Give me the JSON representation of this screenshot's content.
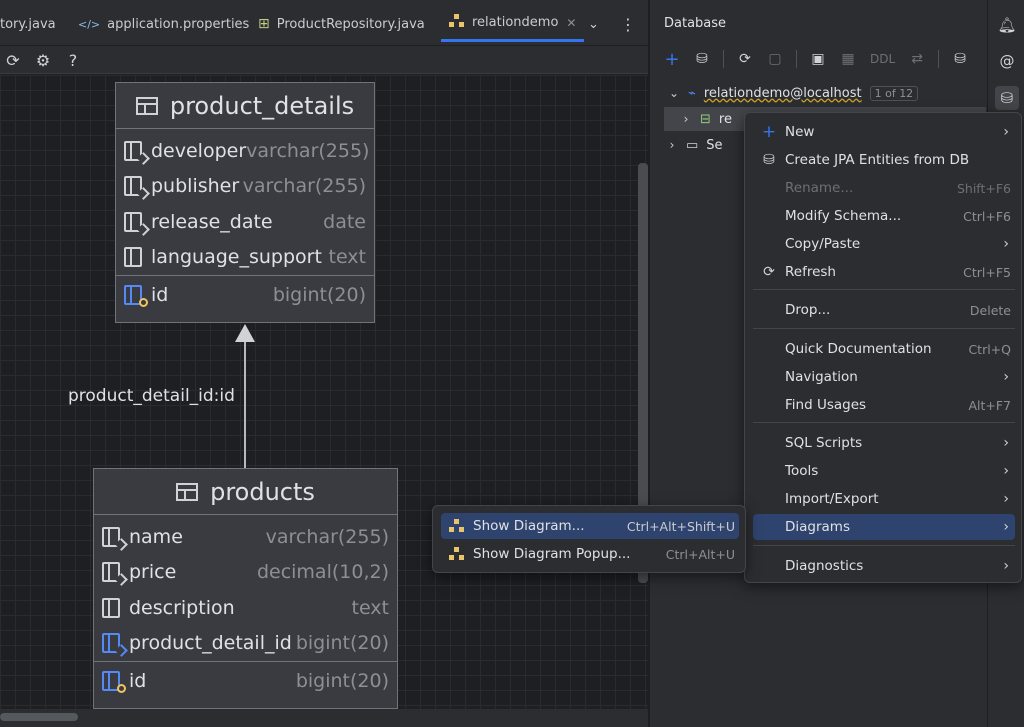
{
  "tabs": [
    {
      "label": "tory.java",
      "icon": "java-file-icon",
      "active": false
    },
    {
      "label": "application.properties",
      "icon": "code-file-icon",
      "active": false
    },
    {
      "label": "ProductRepository.java",
      "icon": "repository-icon",
      "active": false
    },
    {
      "label": "relationdemo",
      "icon": "diagram-icon",
      "active": true
    }
  ],
  "diagram": {
    "tables": [
      {
        "name": "product_details",
        "columns": [
          {
            "name": "developer",
            "type": "varchar(255)",
            "kind": "column"
          },
          {
            "name": "publisher",
            "type": "varchar(255)",
            "kind": "column"
          },
          {
            "name": "release_date",
            "type": "date",
            "kind": "column"
          },
          {
            "name": "language_support",
            "type": "text",
            "kind": "column"
          }
        ],
        "key": {
          "name": "id",
          "type": "bigint(20)"
        }
      },
      {
        "name": "products",
        "columns": [
          {
            "name": "name",
            "type": "varchar(255)",
            "kind": "column"
          },
          {
            "name": "price",
            "type": "decimal(10,2)",
            "kind": "column"
          },
          {
            "name": "description",
            "type": "text",
            "kind": "column"
          },
          {
            "name": "product_detail_id",
            "type": "bigint(20)",
            "kind": "foreign-key"
          }
        ],
        "key": {
          "name": "id",
          "type": "bigint(20)"
        }
      }
    ],
    "relation_label": "product_detail_id:id"
  },
  "db_panel": {
    "title": "Database",
    "toolbar_ddl": "DDL",
    "datasource": "relationdemo@localhost",
    "datasource_count": "1 of 12",
    "child1": "re",
    "child2": "Se"
  },
  "context_menu": {
    "items": [
      {
        "label": "New",
        "shortcut": "",
        "submenu": true
      },
      {
        "label": "Create JPA Entities from DB",
        "shortcut": "",
        "submenu": false
      },
      {
        "label": "Rename...",
        "shortcut": "Shift+F6",
        "submenu": false
      },
      {
        "label": "Modify Schema...",
        "shortcut": "Ctrl+F6",
        "submenu": false
      },
      {
        "label": "Copy/Paste",
        "shortcut": "",
        "submenu": true
      },
      {
        "label": "Refresh",
        "shortcut": "Ctrl+F5",
        "submenu": false
      },
      {
        "label": "Drop...",
        "shortcut": "Delete",
        "submenu": false
      },
      {
        "label": "Quick Documentation",
        "shortcut": "Ctrl+Q",
        "submenu": false
      },
      {
        "label": "Navigation",
        "shortcut": "",
        "submenu": true
      },
      {
        "label": "Find Usages",
        "shortcut": "Alt+F7",
        "submenu": false
      },
      {
        "label": "SQL Scripts",
        "shortcut": "",
        "submenu": true
      },
      {
        "label": "Tools",
        "shortcut": "",
        "submenu": true
      },
      {
        "label": "Import/Export",
        "shortcut": "",
        "submenu": true
      },
      {
        "label": "Diagrams",
        "shortcut": "",
        "submenu": true
      },
      {
        "label": "Diagnostics",
        "shortcut": "",
        "submenu": true
      }
    ]
  },
  "submenu": {
    "items": [
      {
        "label": "Show Diagram...",
        "shortcut": "Ctrl+Alt+Shift+U"
      },
      {
        "label": "Show Diagram Popup...",
        "shortcut": "Ctrl+Alt+U"
      }
    ]
  },
  "colors": {
    "accent": "#3574f0",
    "menu_highlight": "#2e436e",
    "key_icon": "#f2c55c",
    "diagram_icon": "#e9c46a"
  }
}
